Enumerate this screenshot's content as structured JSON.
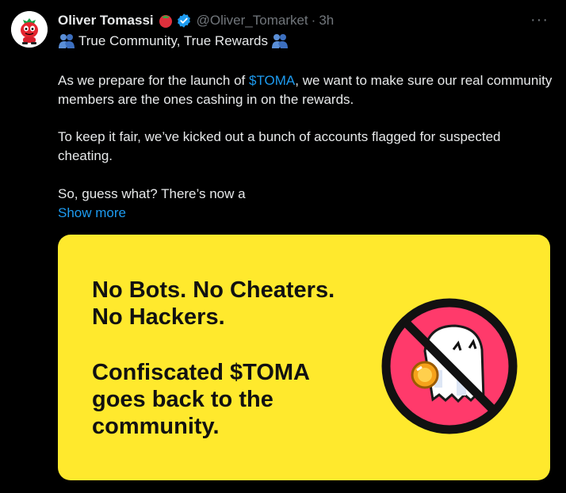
{
  "tweet": {
    "display_name": "Oliver Tomassi",
    "handle": "@Oliver_Tomarket",
    "separator": "·",
    "time": "3h",
    "more_icon": "more-horizontal-icon",
    "more_glyph": "···",
    "title": "True Community, True Rewards",
    "body_p1_before": "As we prepare for the launch of ",
    "body_p1_cashtag": "$TOMA",
    "body_p1_after": ", we want to make sure our real community members are the ones cashing in on the rewards.",
    "body_p2": "To keep it fair, we’ve kicked out a bunch of accounts flagged for suspected cheating.",
    "body_p3": "So, guess what? There’s now a",
    "show_more": "Show more"
  },
  "media": {
    "background": "#ffe92d",
    "line1": "No Bots. No Cheaters.",
    "line2": "No Hackers.",
    "line3": "Confiscated $TOMA",
    "line4": "goes back to the",
    "line5": "community."
  },
  "colors": {
    "link": "#1d9bf0",
    "muted": "#71767b",
    "verified": "#1d9bf0",
    "ban_ring": "#111111",
    "ban_fill": "#ff3a6b"
  }
}
